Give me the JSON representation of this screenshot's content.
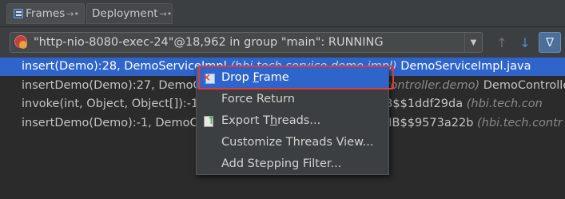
{
  "tabs": [
    {
      "label": "Frames",
      "pin": "→•"
    },
    {
      "label": "Deployment",
      "pin": "→•"
    }
  ],
  "thread": {
    "label": "\"http-nio-8080-exec-24\"@18,962 in group \"main\": RUNNING",
    "dropdown_glyph": "▼"
  },
  "toolbar": {
    "up_glyph": "↑",
    "down_glyph": "↓",
    "filter_glyph": "∇"
  },
  "frames": [
    {
      "method": "insert(Demo):28, DemoServiceImpl",
      "pkg": "(hbi.tech.service.demo.impl)",
      "file": "DemoServiceImpl.java"
    },
    {
      "method": "insertDemo(Demo):27, DemoC",
      "pkg": "tech.controller.demo)",
      "file": "DemoController.java"
    },
    {
      "method": "invoke(int, Object, Object[]):-1",
      "pkg": "(hbi.tech.con",
      "file": "GLIB$$1ddf29da"
    },
    {
      "method": "insertDemo(Demo):-1, DemoC",
      "pkg": "(hbi.tech.contr",
      "file": "LIB$$9573a22b"
    }
  ],
  "context_menu": {
    "items": [
      {
        "pre": "Drop ",
        "u": "F",
        "post": "rame"
      },
      {
        "pre": "Force Return",
        "u": "",
        "post": ""
      },
      {
        "pre": "Export T",
        "u": "h",
        "post": "reads..."
      },
      {
        "pre": "Customize Threads View...",
        "u": "",
        "post": ""
      },
      {
        "pre": "Add Stepping Filter...",
        "u": "",
        "post": ""
      }
    ]
  },
  "colors": {
    "selection": "#2f65ca",
    "highlight_outline": "#e03a3a",
    "background": "#2b2b2b"
  }
}
